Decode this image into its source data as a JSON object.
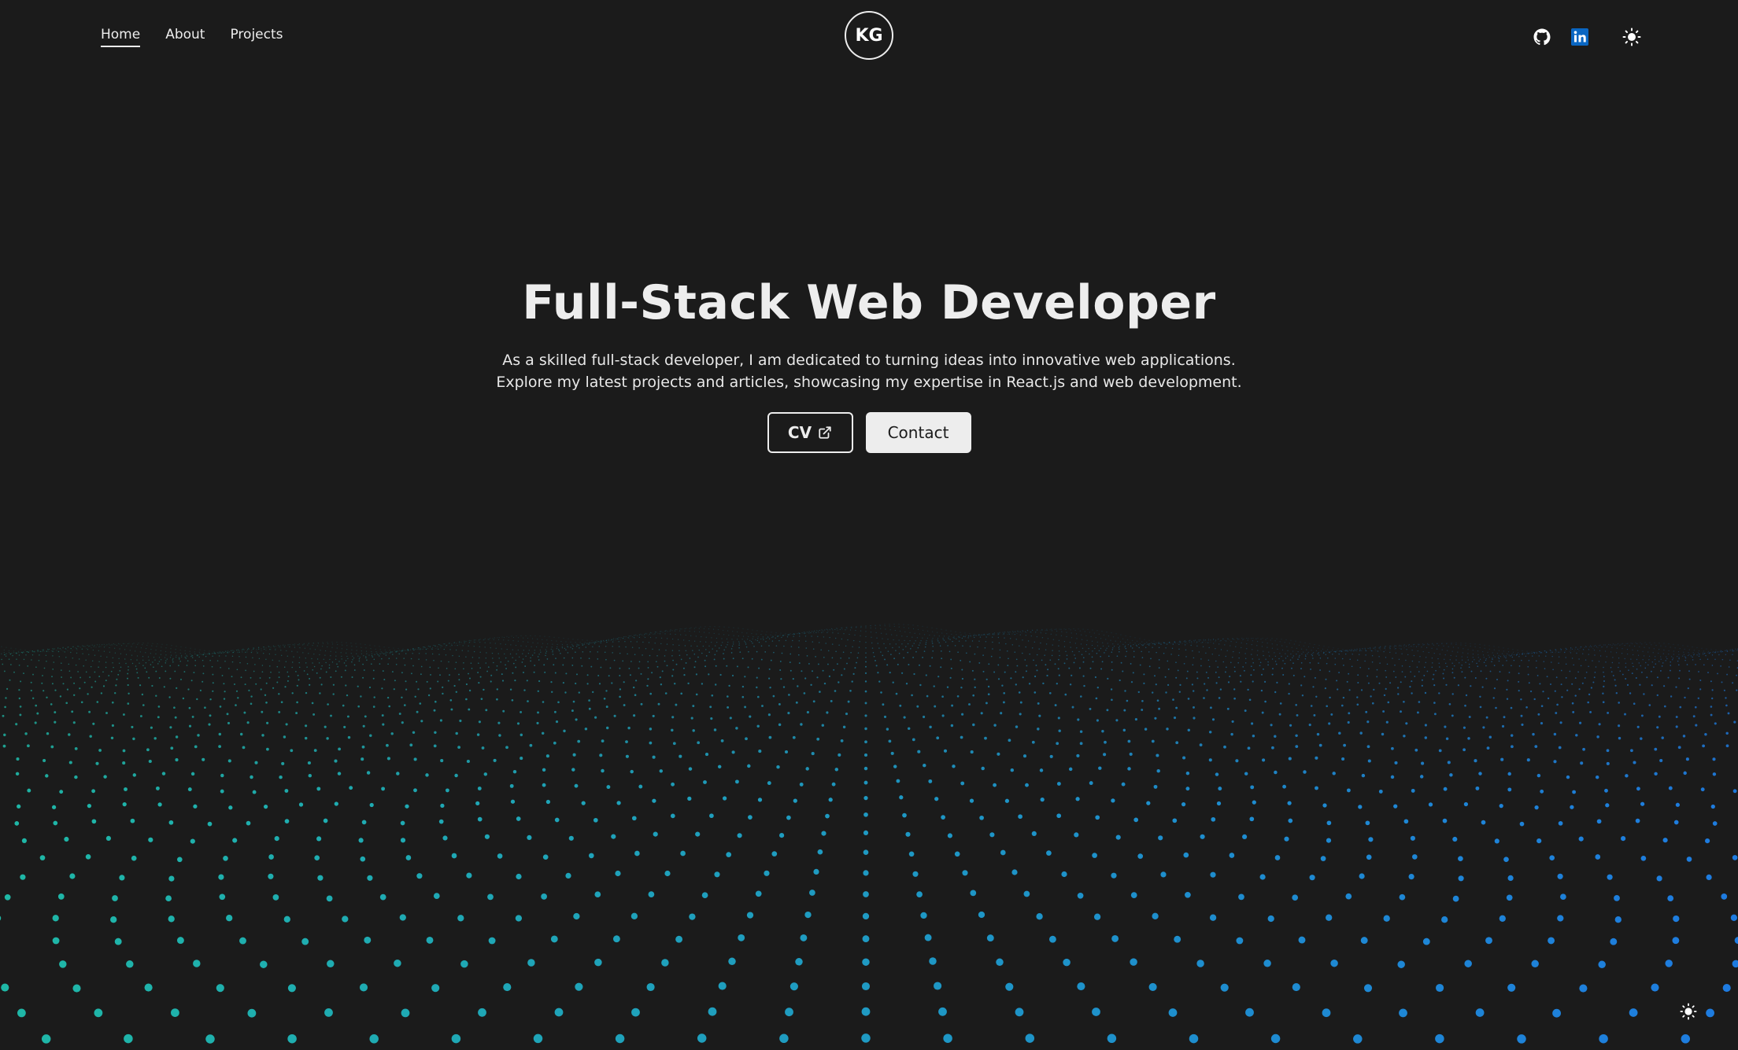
{
  "nav": {
    "items": [
      {
        "label": "Home",
        "active": true
      },
      {
        "label": "About",
        "active": false
      },
      {
        "label": "Projects",
        "active": false
      }
    ]
  },
  "logo": {
    "text": "KG"
  },
  "social": {
    "icons": [
      "github-icon",
      "linkedin-icon",
      "sun-icon"
    ],
    "linkedin_color": "#0a66c2"
  },
  "hero": {
    "title": "Full-Stack Web Developer",
    "description": "As a skilled full-stack developer, I am dedicated to turning ideas into innovative web applications. Explore my latest projects and articles, showcasing my expertise in React.js and web development.",
    "cv_label": "CV",
    "contact_label": "Contact"
  },
  "colors": {
    "background": "#1b1b1b",
    "text": "#ededed",
    "wave_left": "#1fb8a6",
    "wave_right": "#1e7be0"
  }
}
